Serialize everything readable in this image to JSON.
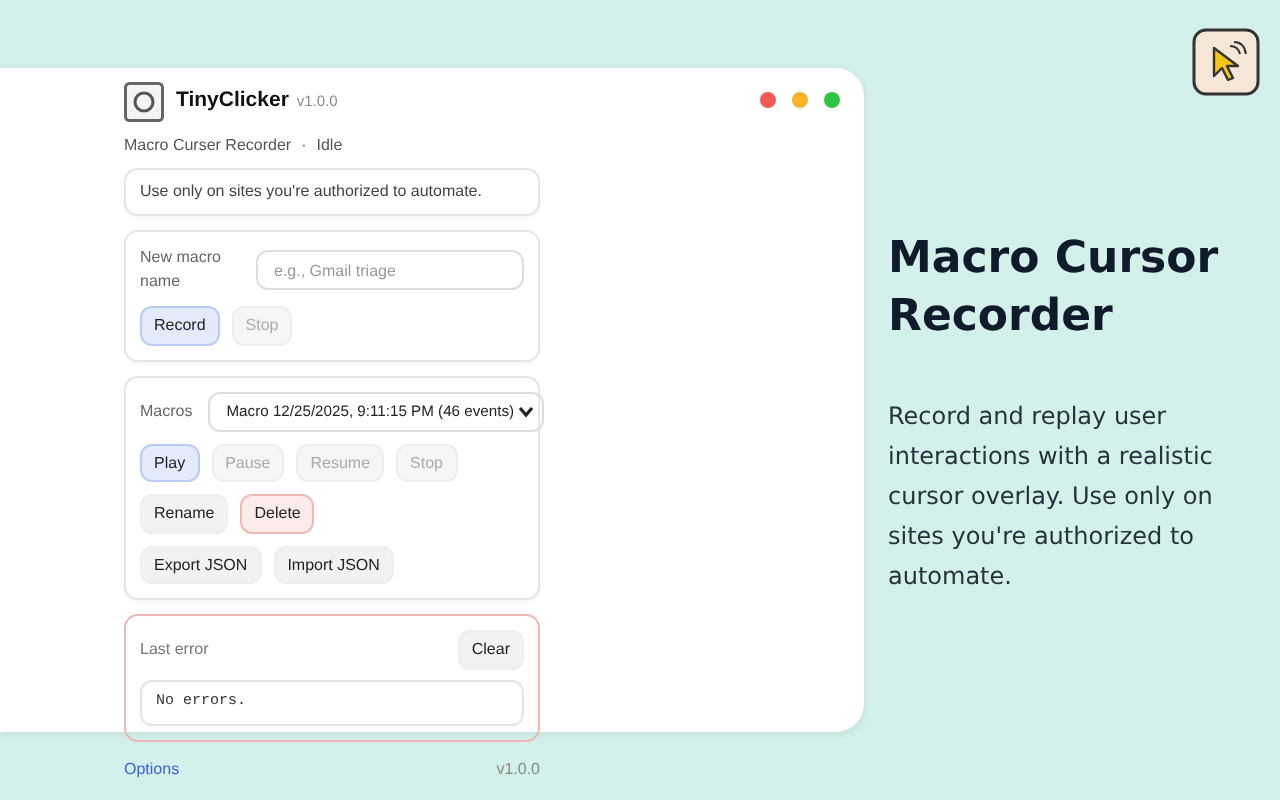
{
  "popup": {
    "app_name": "TinyClicker",
    "version": "v1.0.0",
    "subtitle": "Macro Curser Recorder",
    "separator": "·",
    "status": "Idle",
    "notice": "Use only on sites you're authorized to automate.",
    "new_macro": {
      "label": "New macro name",
      "placeholder": "e.g., Gmail triage",
      "buttons": [
        {
          "label": "Record",
          "kind": "primary",
          "disabled": false
        },
        {
          "label": "Stop",
          "kind": "normal",
          "disabled": true
        }
      ]
    },
    "macros": {
      "label": "Macros",
      "selected_macro": "Macro 12/25/2025, 9:11:15 PM (46 events)",
      "button_rows": [
        [
          {
            "label": "Play",
            "kind": "primary",
            "disabled": false
          },
          {
            "label": "Pause",
            "kind": "normal",
            "disabled": true
          },
          {
            "label": "Resume",
            "kind": "normal",
            "disabled": true
          },
          {
            "label": "Stop",
            "kind": "normal",
            "disabled": true
          }
        ],
        [
          {
            "label": "Rename",
            "kind": "normal",
            "disabled": false
          },
          {
            "label": "Delete",
            "kind": "danger",
            "disabled": false
          }
        ],
        [
          {
            "label": "Export JSON",
            "kind": "normal",
            "disabled": false
          },
          {
            "label": "Import JSON",
            "kind": "normal",
            "disabled": false
          }
        ]
      ]
    },
    "last_error": {
      "label": "Last error",
      "clear_button": "Clear",
      "message": "No errors."
    },
    "footer": {
      "options_link": "Options",
      "version": "v1.0.0"
    }
  },
  "promo": {
    "title": "Macro Cursor Recorder",
    "description": "Record and replay user interactions with a realistic cursor overlay. Use only on sites you're authorized to automate."
  }
}
